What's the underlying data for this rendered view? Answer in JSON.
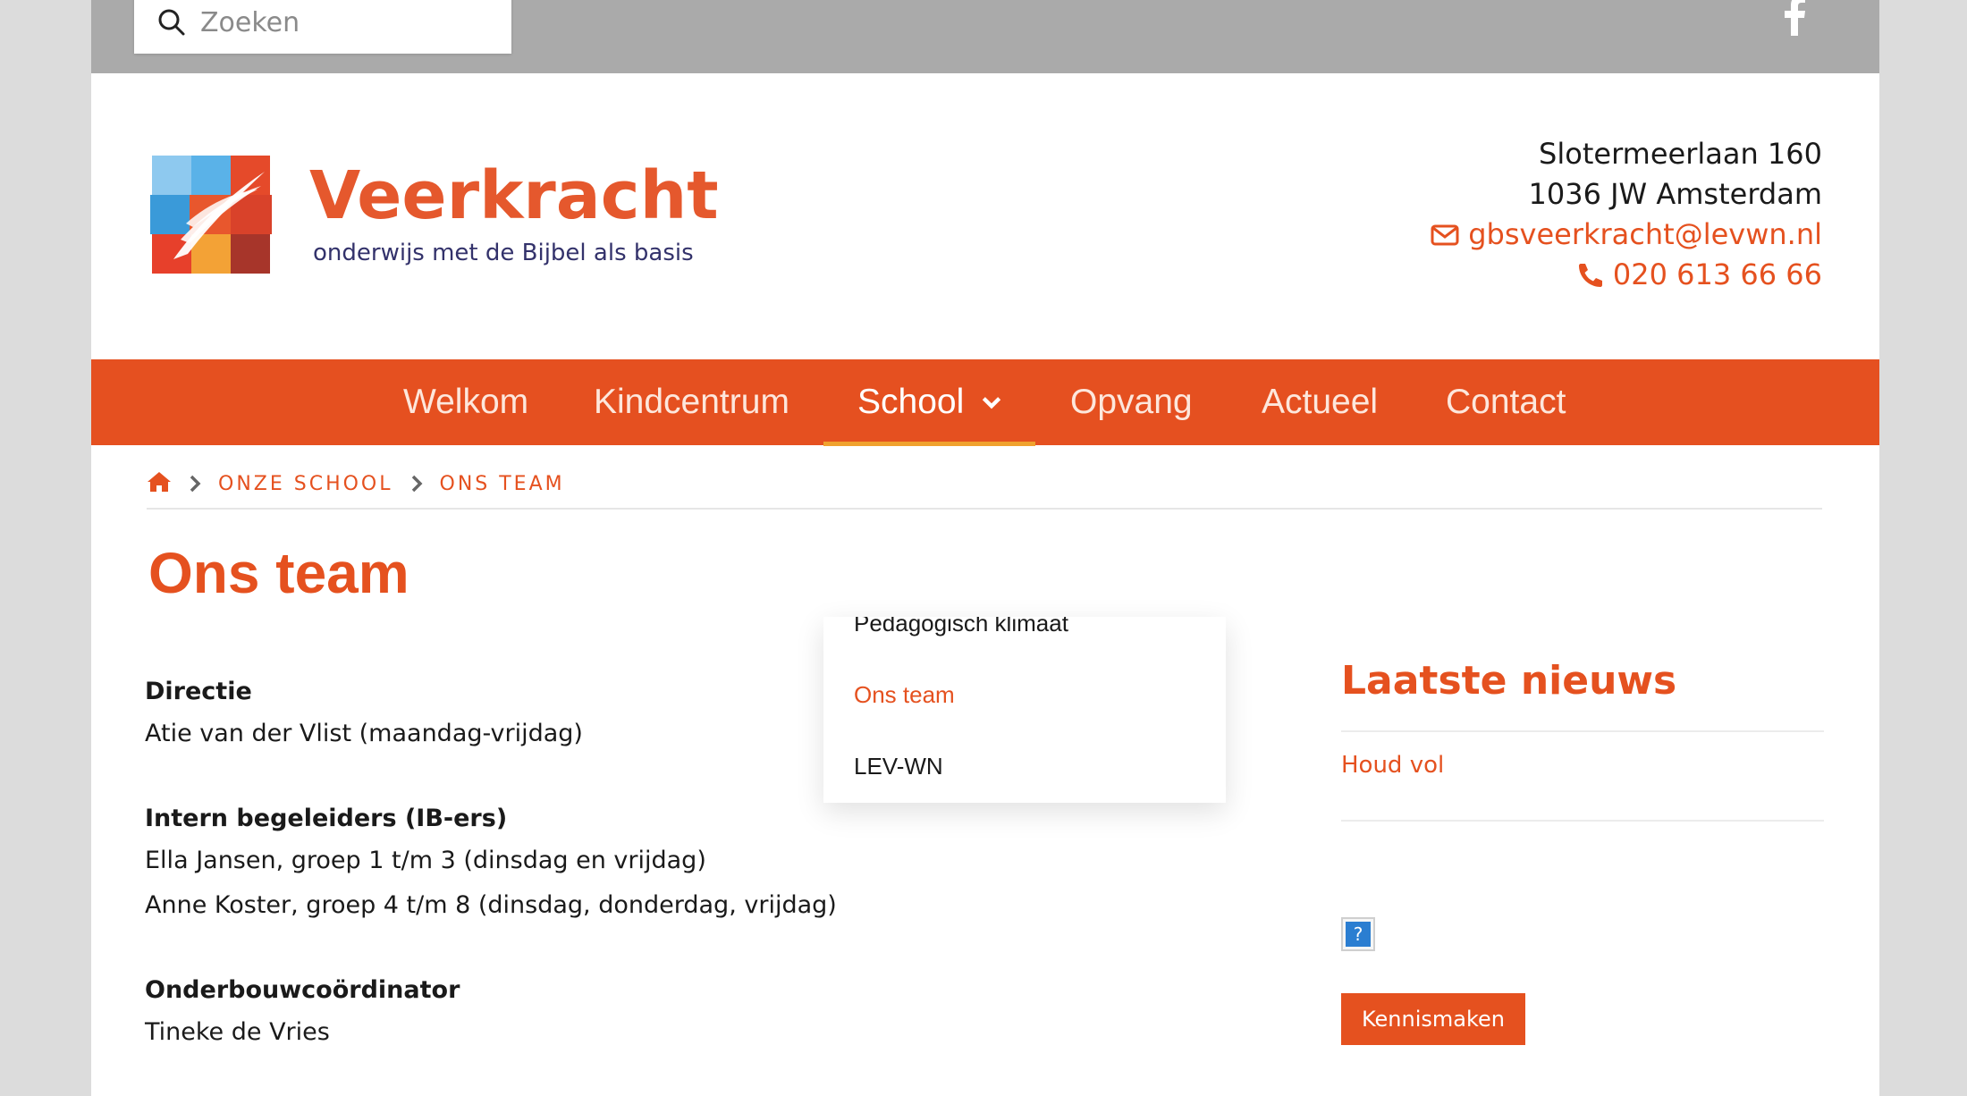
{
  "search": {
    "placeholder": "Zoeken"
  },
  "brand": {
    "name": "Veerkracht",
    "tagline": "onderwijs met de Bijbel als basis",
    "accent": "#e55020",
    "navy": "#33326b"
  },
  "contact": {
    "street": "Slotermeerlaan 160",
    "city": "1036 JW Amsterdam",
    "email": "gbsveerkracht@levwn.nl",
    "phone": "020 613 66 66"
  },
  "nav": {
    "items": [
      {
        "label": "Welkom"
      },
      {
        "label": "Kindcentrum"
      },
      {
        "label": "School",
        "active": true
      },
      {
        "label": "Opvang"
      },
      {
        "label": "Actueel"
      },
      {
        "label": "Contact"
      }
    ]
  },
  "breadcrumb": {
    "items": [
      "ONZE SCHOOL",
      "ONS TEAM"
    ]
  },
  "page": {
    "title": "Ons team"
  },
  "team": [
    {
      "heading": "Directie",
      "lines": [
        "Atie van der Vlist (maandag-vrijdag)"
      ]
    },
    {
      "heading": "Intern begeleiders (IB-ers)",
      "lines": [
        "Ella Jansen, groep 1 t/m 3 (dinsdag en vrijdag)",
        "Anne Koster, groep 4 t/m 8 (dinsdag, donderdag, vrijdag)"
      ]
    },
    {
      "heading": "Onderbouwcoördinator",
      "lines": [
        "Tineke de Vries"
      ]
    }
  ],
  "dropdown": {
    "items": [
      "Pedagogisch klimaat",
      "Ons team",
      "LEV-WN"
    ],
    "current": "Ons team"
  },
  "sidebar": {
    "news_title": "Laatste nieuws",
    "news_items": [
      "Houd vol"
    ],
    "help_symbol": "?",
    "cta_label": "Kennismaken"
  },
  "icons": [
    "search-icon",
    "facebook-icon",
    "envelope-icon",
    "phone-icon",
    "home-icon",
    "chevron-right-icon",
    "chevron-down-icon",
    "help-icon"
  ]
}
